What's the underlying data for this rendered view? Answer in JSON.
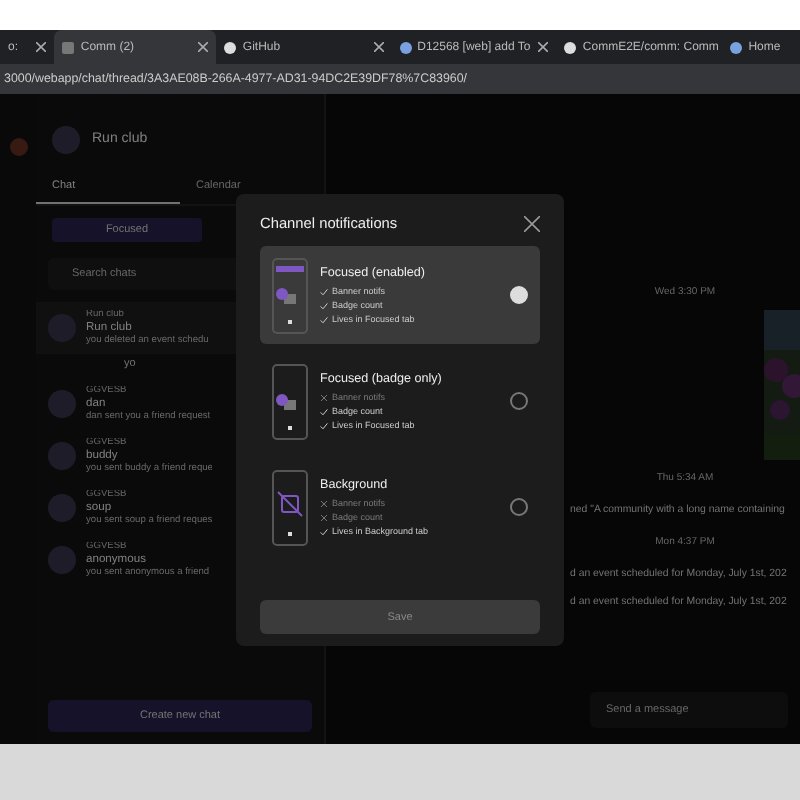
{
  "browser": {
    "tabs": [
      {
        "label": "o:",
        "selected": false
      },
      {
        "label": "Comm (2)",
        "selected": true
      },
      {
        "label": "GitHub",
        "selected": false
      },
      {
        "label": "D12568 [web] add To",
        "selected": false
      },
      {
        "label": "CommE2E/comm: Comm",
        "selected": false
      },
      {
        "label": "Home",
        "selected": false
      }
    ],
    "url": "3000/webapp/chat/thread/3A3AE08B-266A-4977-AD31-94DC2E39DF78%7C83960/"
  },
  "sidebar": {
    "community": "Run club",
    "tabs": [
      {
        "label": "Chat",
        "selected": true
      },
      {
        "label": "Calendar",
        "selected": false
      }
    ],
    "filter": "Focused",
    "search": {
      "placeholder": "Search chats"
    },
    "threads": [
      {
        "community": "Run club",
        "name": "Run club",
        "preview": "you deleted an event schedu",
        "selected": true
      },
      {
        "community": "GGVESB",
        "name": "dan",
        "preview": "dan sent you a friend request",
        "selected": false
      },
      {
        "community": "GGVESB",
        "name": "buddy",
        "preview": "you sent buddy a friend reque",
        "selected": false
      },
      {
        "community": "GGVESB",
        "name": "soup",
        "preview": "you sent soup a friend reques",
        "selected": false
      },
      {
        "community": "GGVESB",
        "name": "anonymous",
        "preview": "you sent anonymous a friend",
        "selected": false
      }
    ],
    "subthread": "yo",
    "create_button": "Create new chat"
  },
  "chat": {
    "messages": [
      {
        "kind": "time",
        "text": "Wed 3:30 PM"
      },
      {
        "kind": "picture"
      },
      {
        "kind": "time",
        "text": "Thu 5:34 AM"
      },
      {
        "kind": "text",
        "text": "ned \"A community with a long name containing"
      },
      {
        "kind": "time",
        "text": "Mon 4:37 PM"
      },
      {
        "kind": "text",
        "text": "d an event scheduled for Monday, July 1st, 202"
      },
      {
        "kind": "text",
        "text": "d an event scheduled for Monday, July 1st, 202"
      }
    ],
    "composer": {
      "placeholder": "Send a message"
    }
  },
  "dialog": {
    "title": "Channel notifications",
    "options": [
      {
        "kind": "enabled",
        "title": "Focused (enabled)",
        "selected": true,
        "features": [
          {
            "label": "Banner notifs",
            "on": true
          },
          {
            "label": "Badge count",
            "on": true
          },
          {
            "label": "Lives in Focused tab",
            "on": true
          }
        ]
      },
      {
        "kind": "badge",
        "title": "Focused (badge only)",
        "selected": false,
        "features": [
          {
            "label": "Banner notifs",
            "on": false
          },
          {
            "label": "Badge count",
            "on": true
          },
          {
            "label": "Lives in Focused tab",
            "on": true
          }
        ]
      },
      {
        "kind": "background",
        "title": "Background",
        "selected": false,
        "features": [
          {
            "label": "Banner notifs",
            "on": false
          },
          {
            "label": "Badge count",
            "on": false
          },
          {
            "label": "Lives in Background tab",
            "on": true
          }
        ]
      }
    ],
    "save": {
      "label": "Save",
      "disabled": true
    }
  }
}
